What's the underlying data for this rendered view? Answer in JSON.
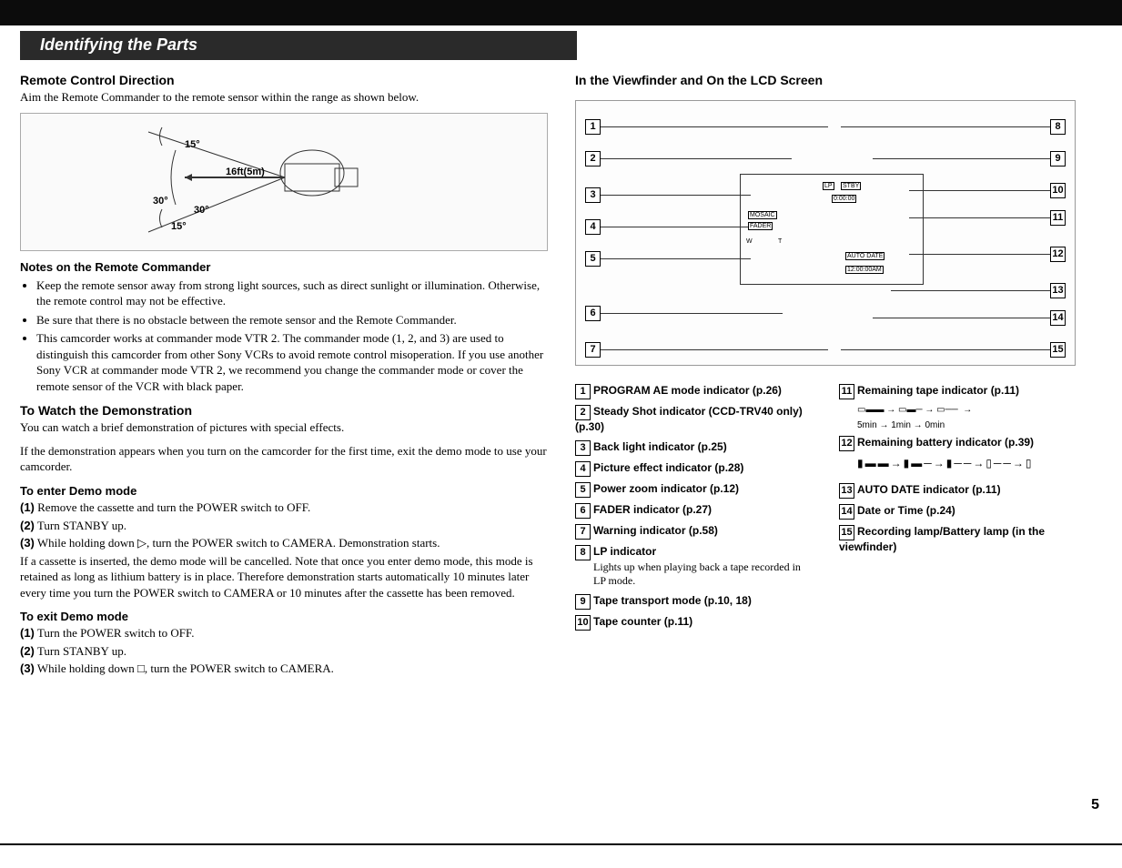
{
  "header": "Identifying the Parts",
  "left": {
    "remote_dir": "Remote Control Direction",
    "remote_dir_text": "Aim the Remote Commander to the remote sensor within the range as shown below.",
    "fig_angle_top": "15°",
    "fig_angle_bot": "15°",
    "fig_angle_30a": "30°",
    "fig_angle_30b": "30°",
    "fig_dist": "16ft(5m)",
    "notes_head": "Notes on the Remote Commander",
    "note1": "Keep the remote sensor away from strong light sources, such as direct sunlight or illumination. Otherwise, the remote control may not be effective.",
    "note2": "Be sure that there is no obstacle between the remote sensor and the Remote Commander.",
    "note3": "This camcorder works at commander mode VTR 2. The commander mode (1, 2, and 3) are used to distinguish this camcorder from other Sony VCRs to avoid remote control misoperation. If you use another Sony VCR at commander mode VTR 2, we recommend you change the commander mode or cover the remote sensor of the VCR with black paper.",
    "demo_head": "To Watch the Demonstration",
    "demo_text1": "You can watch a brief demonstration of pictures with special effects.",
    "demo_text2": "If the demonstration appears when you turn on the camcorder for the first time, exit the demo mode to use your camcorder.",
    "enter_head": "To enter Demo mode",
    "enter1_n": "(1)",
    "enter1": "Remove the cassette and turn the POWER switch to OFF.",
    "enter2_n": "(2)",
    "enter2": "Turn STANBY up.",
    "enter3_n": "(3)",
    "enter3": "While holding down ▷, turn the POWER switch to CAMERA. Demonstration starts.",
    "enter_note": "If a cassette is inserted, the demo mode will be cancelled. Note that once you enter demo mode, this mode is retained as long as lithium battery is in place. Therefore demonstration starts automatically 10 minutes later every time you turn the POWER switch to CAMERA or 10 minutes after the cassette has been removed.",
    "exit_head": "To exit Demo mode",
    "exit1_n": "(1)",
    "exit1": "Turn the POWER switch to OFF.",
    "exit2_n": "(2)",
    "exit2": "Turn STANBY up.",
    "exit3_n": "(3)",
    "exit3": "While holding down □, turn the POWER switch to CAMERA."
  },
  "right": {
    "vf_header": "In the Viewfinder and On the LCD Screen",
    "n1": "1",
    "n2": "2",
    "n3": "3",
    "n4": "4",
    "n5": "5",
    "n6": "6",
    "n7": "7",
    "n8": "8",
    "n9": "9",
    "n10": "10",
    "n11": "11",
    "n12": "12",
    "n13": "13",
    "n14": "14",
    "n15": "15",
    "osd_lp": "LP",
    "osd_stby": "STBY",
    "osd_counter": "0:00:00",
    "osd_mosaic": "MOSAIC",
    "osd_fader": "FADER",
    "osd_autodate": "AUTO DATE",
    "osd_time": "12:00:00AM",
    "osd_w": "W",
    "osd_t": "T",
    "leg1": "PROGRAM AE mode indicator (p.26)",
    "leg2": "Steady Shot indicator (CCD-TRV40 only) (p.30)",
    "leg3": "Back light indicator (p.25)",
    "leg4": "Picture effect indicator (p.28)",
    "leg5": "Power zoom indicator (p.12)",
    "leg6": "FADER indicator (p.27)",
    "leg7": "Warning indicator (p.58)",
    "leg8": "LP indicator",
    "leg8_sub": "Lights up when playing back a tape recorded in LP mode.",
    "leg9": "Tape transport mode (p.10, 18)",
    "leg10": "Tape counter (p.11)",
    "leg11": "Remaining tape indicator (p.11)",
    "tape_line": "5min  →  1min  →  0min",
    "leg12": "Remaining battery indicator (p.39)",
    "leg13": "AUTO DATE indicator (p.11)",
    "leg14": "Date or Time (p.24)",
    "leg15": "Recording lamp/Battery lamp (in the viewfinder)"
  },
  "page_num": "5"
}
